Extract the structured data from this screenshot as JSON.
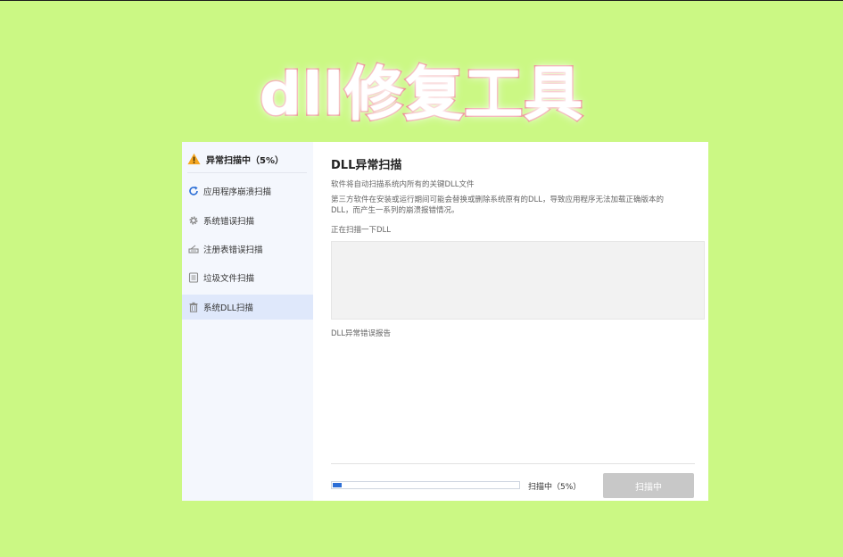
{
  "banner": {
    "title": "dll修复工具"
  },
  "sidebar": {
    "scan_status": "异常扫描中（5%）",
    "items": [
      {
        "label": "应用程序崩溃扫描",
        "icon": "refresh-icon"
      },
      {
        "label": "系统错误扫描",
        "icon": "gear-icon"
      },
      {
        "label": "注册表错误扫描",
        "icon": "registry-icon"
      },
      {
        "label": "垃圾文件扫描",
        "icon": "file-icon"
      },
      {
        "label": "系统DLL扫描",
        "icon": "trash-icon",
        "active": true
      }
    ]
  },
  "main": {
    "title": "DLL异常扫描",
    "desc_line1": "软件将自动扫描系统内所有的关键DLL文件",
    "desc_line2": "第三方软件在安装或运行期间可能会替换或删除系统原有的DLL，导致应用程序无法加载正确版本的",
    "desc_line3": "DLL，而产生一系列的崩溃报错情况。",
    "scanning_label": "正在扫描一下DLL",
    "report_label": "DLL异常错误报告",
    "progress_text": "扫描中（5%）",
    "progress_percent": 5,
    "scan_button_label": "扫描中"
  },
  "colors": {
    "background": "#cbf884",
    "title_stroke": "#e9767c",
    "accent": "#2d6fd6",
    "sidebar_active": "#dfe8fb",
    "button_disabled": "#c8c8c8"
  }
}
